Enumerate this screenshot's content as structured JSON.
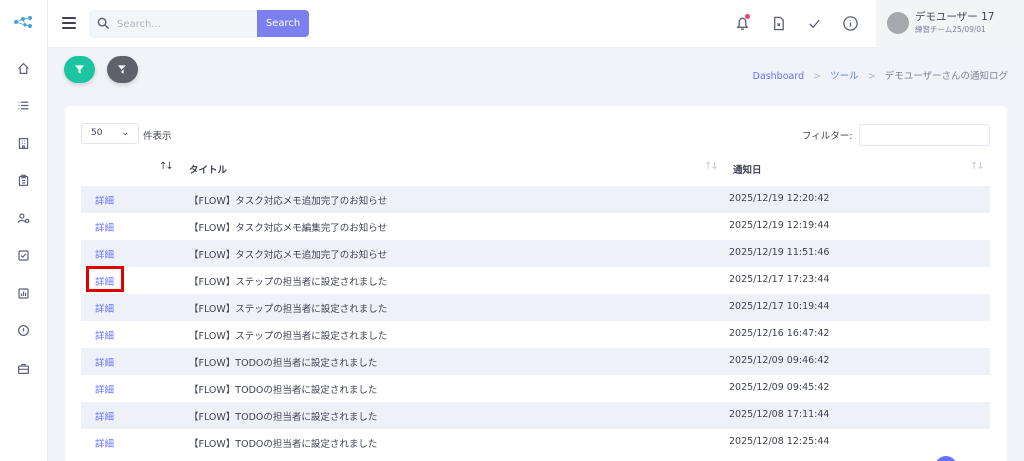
{
  "search": {
    "placeholder": "Search...",
    "button_label": "Search"
  },
  "user": {
    "name": "デモユーザー 17",
    "team": "練習チーム25/09/01"
  },
  "breadcrumb": {
    "home": "Dashboard",
    "tools": "ツール",
    "current": "デモユーザーさんの通知ログ",
    "separator": ">"
  },
  "table_controls": {
    "page_length": "50",
    "length_label": "件表示",
    "filter_label": "フィルター:"
  },
  "columns": {
    "title": "タイトル",
    "date": "通知日"
  },
  "rows": [
    {
      "detail": "詳細",
      "title": "【FLOW】タスク対応メモ追加完了のお知らせ",
      "date": "2025/12/19 12:20:42"
    },
    {
      "detail": "詳細",
      "title": "【FLOW】タスク対応メモ編集完了のお知らせ",
      "date": "2025/12/19 12:19:44"
    },
    {
      "detail": "詳細",
      "title": "【FLOW】タスク対応メモ追加完了のお知らせ",
      "date": "2025/12/19 11:51:46"
    },
    {
      "detail": "詳細",
      "title": "【FLOW】ステップの担当者に設定されました",
      "date": "2025/12/17 17:23:44"
    },
    {
      "detail": "詳細",
      "title": "【FLOW】ステップの担当者に設定されました",
      "date": "2025/12/17 10:19:44"
    },
    {
      "detail": "詳細",
      "title": "【FLOW】ステップの担当者に設定されました",
      "date": "2025/12/16 16:47:42"
    },
    {
      "detail": "詳細",
      "title": "【FLOW】TODOの担当者に設定されました",
      "date": "2025/12/09 09:46:42"
    },
    {
      "detail": "詳細",
      "title": "【FLOW】TODOの担当者に設定されました",
      "date": "2025/12/09 09:45:42"
    },
    {
      "detail": "詳細",
      "title": "【FLOW】TODOの担当者に設定されました",
      "date": "2025/12/08 17:11:44"
    },
    {
      "detail": "詳細",
      "title": "【FLOW】TODOの担当者に設定されました",
      "date": "2025/12/08 12:25:44"
    }
  ],
  "sidebar_icons": [
    "home-icon",
    "list-icon",
    "building-icon",
    "clipboard-icon",
    "user-settings-icon",
    "checkbox-icon",
    "chart-icon",
    "info-icon",
    "briefcase-icon"
  ],
  "colors": {
    "accent": "#6571ff",
    "search_button": "#7b7ff0",
    "filter_fab": "#1bc5a0",
    "clear_fab": "#5e6169",
    "highlight": "#e00000",
    "row_stripe": "#eef2f8"
  }
}
